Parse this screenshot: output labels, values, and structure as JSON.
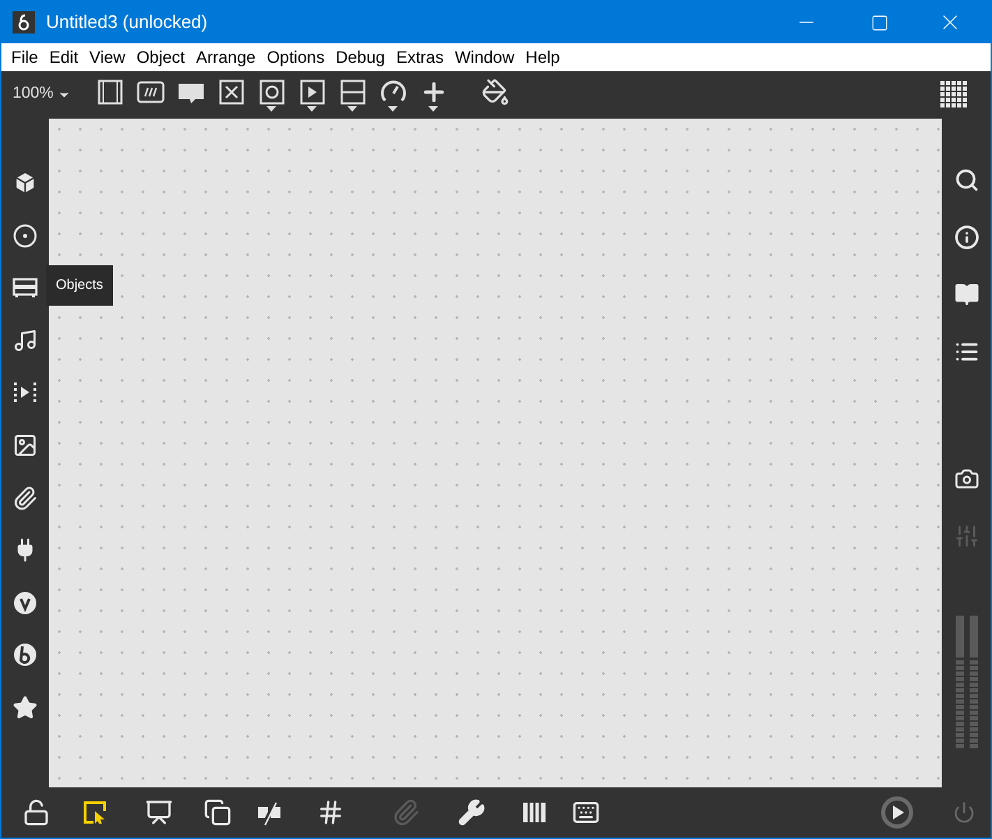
{
  "window": {
    "title": "Untitled3 (unlocked)"
  },
  "menu": [
    {
      "label": "File"
    },
    {
      "label": "Edit"
    },
    {
      "label": "View"
    },
    {
      "label": "Object"
    },
    {
      "label": "Arrange"
    },
    {
      "label": "Options"
    },
    {
      "label": "Debug"
    },
    {
      "label": "Extras"
    },
    {
      "label": "Window"
    },
    {
      "label": "Help"
    }
  ],
  "toolbar": {
    "zoom": "100%",
    "tools": [
      {
        "kind": "object",
        "dropdown": false
      },
      {
        "kind": "message",
        "dropdown": false
      },
      {
        "kind": "comment",
        "dropdown": false
      },
      {
        "kind": "toggle",
        "dropdown": false
      },
      {
        "kind": "button",
        "dropdown": true
      },
      {
        "kind": "playbutton",
        "dropdown": true
      },
      {
        "kind": "slider",
        "dropdown": true
      },
      {
        "kind": "dial",
        "dropdown": true
      },
      {
        "kind": "plus",
        "dropdown": true
      },
      {
        "kind": "bucket",
        "dropdown": false
      }
    ]
  },
  "left_sidebar": {
    "items": [
      {
        "kind": "cube"
      },
      {
        "kind": "target"
      },
      {
        "kind": "panel"
      },
      {
        "kind": "note"
      },
      {
        "kind": "media"
      },
      {
        "kind": "image"
      },
      {
        "kind": "clip"
      },
      {
        "kind": "plug"
      },
      {
        "kind": "v"
      },
      {
        "kind": "b"
      },
      {
        "kind": "star"
      }
    ],
    "tooltip": "Objects"
  },
  "right_sidebar": {
    "items": [
      {
        "kind": "search",
        "disabled": false
      },
      {
        "kind": "info",
        "disabled": false
      },
      {
        "kind": "book",
        "disabled": false
      },
      {
        "kind": "list",
        "disabled": false
      },
      {
        "kind": "camera",
        "disabled": false
      },
      {
        "kind": "mixer",
        "disabled": true
      }
    ]
  },
  "bottom_toolbar": {
    "items": [
      {
        "kind": "lock",
        "on": false,
        "disabled": false
      },
      {
        "kind": "edit",
        "on": true,
        "disabled": false
      },
      {
        "kind": "presentation",
        "on": false,
        "disabled": false
      },
      {
        "kind": "layers",
        "on": false,
        "disabled": false
      },
      {
        "kind": "nosnap",
        "on": false,
        "disabled": false
      },
      {
        "kind": "grid",
        "on": false,
        "disabled": false
      },
      {
        "kind": "clipadd",
        "on": false,
        "disabled": true
      },
      {
        "kind": "wrench",
        "on": false,
        "disabled": false
      },
      {
        "kind": "piano",
        "on": false,
        "disabled": false
      },
      {
        "kind": "keyboard",
        "on": false,
        "disabled": false
      }
    ]
  }
}
